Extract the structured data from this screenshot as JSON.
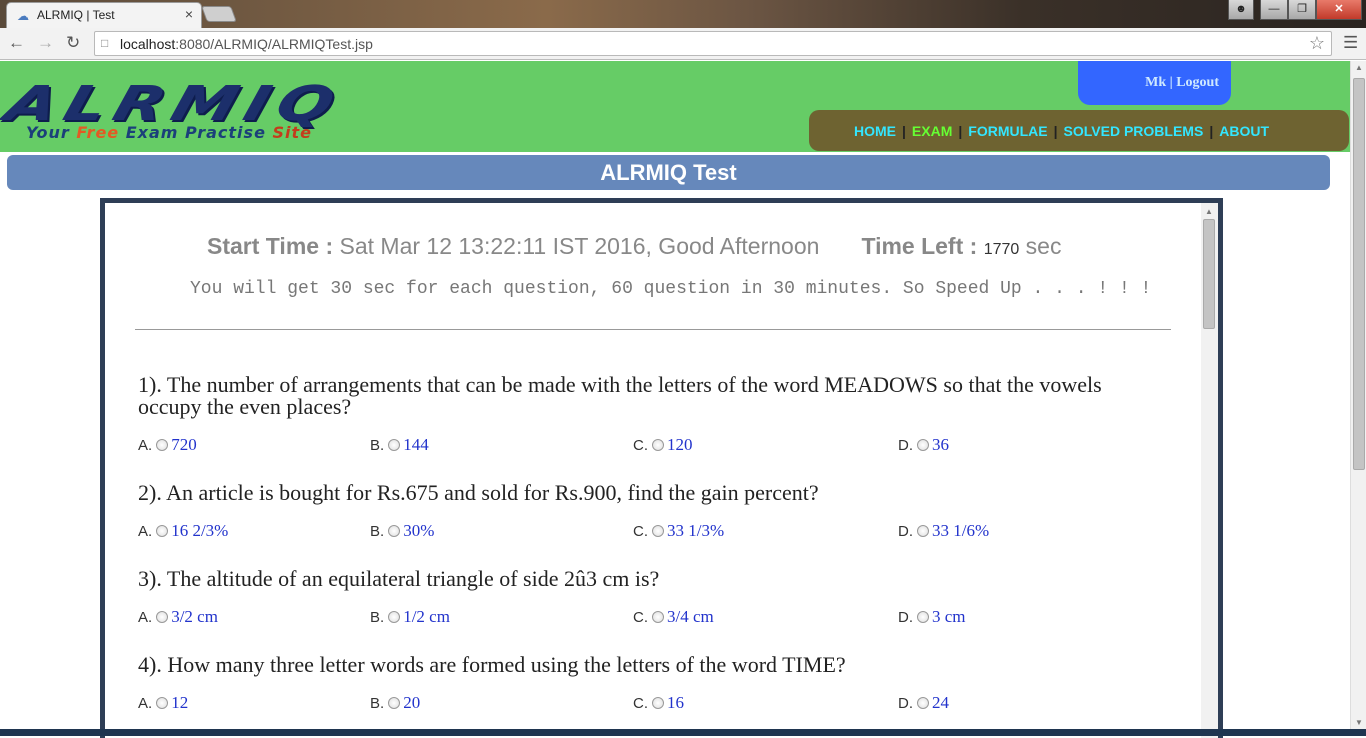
{
  "browser": {
    "tab_title": "ALRMIQ | Test",
    "url_host": "localhost",
    "url_rest": ":8080/ALRMIQ/ALRMIQTest.jsp"
  },
  "header": {
    "logo_text": "ALRMIQ",
    "tagline_1": "Your ",
    "tagline_2": "Free",
    "tagline_3": " Exam Practise ",
    "tagline_4": "Site",
    "user_name": "Mk",
    "user_sep": " | ",
    "logout": "Logout",
    "nav": [
      "HOME",
      "EXAM",
      "FORMULAE",
      "SOLVED PROBLEMS",
      "ABOUT"
    ],
    "nav_sep": "|"
  },
  "page_title": "ALRMIQ Test",
  "status": {
    "start_label": "Start Time :",
    "start_value": " Sat Mar 12 13:22:11 IST 2016, Good Afternoon",
    "time_left_label": "Time Left :",
    "time_left_value": "1770",
    "time_unit": " sec",
    "notice": "You will get 30 sec for each question, 60 question in 30 minutes. So Speed Up . . . ! ! !"
  },
  "questions": [
    {
      "text": "1). The number of arrangements that can be made with the letters of the word MEADOWS so that the vowels occupy the even places?",
      "options": [
        {
          "letter": "A.",
          "value": "720"
        },
        {
          "letter": "B.",
          "value": "144"
        },
        {
          "letter": "C.",
          "value": "120"
        },
        {
          "letter": "D.",
          "value": "36"
        }
      ]
    },
    {
      "text": "2). An article is bought for Rs.675 and sold for Rs.900, find the gain percent?",
      "options": [
        {
          "letter": "A.",
          "value": "16 2/3%"
        },
        {
          "letter": "B.",
          "value": "30%"
        },
        {
          "letter": "C.",
          "value": "33 1/3%"
        },
        {
          "letter": "D.",
          "value": "33 1/6%"
        }
      ]
    },
    {
      "text": "3). The altitude of an equilateral triangle of side 2û3 cm is?",
      "options": [
        {
          "letter": "A.",
          "value": "3/2 cm"
        },
        {
          "letter": "B.",
          "value": "1/2 cm"
        },
        {
          "letter": "C.",
          "value": "3/4 cm"
        },
        {
          "letter": "D.",
          "value": "3 cm"
        }
      ]
    },
    {
      "text": "4). How many three letter words are formed using the letters of the word TIME?",
      "options": [
        {
          "letter": "A.",
          "value": "12"
        },
        {
          "letter": "B.",
          "value": "20"
        },
        {
          "letter": "C.",
          "value": "16"
        },
        {
          "letter": "D.",
          "value": "24"
        }
      ]
    }
  ]
}
